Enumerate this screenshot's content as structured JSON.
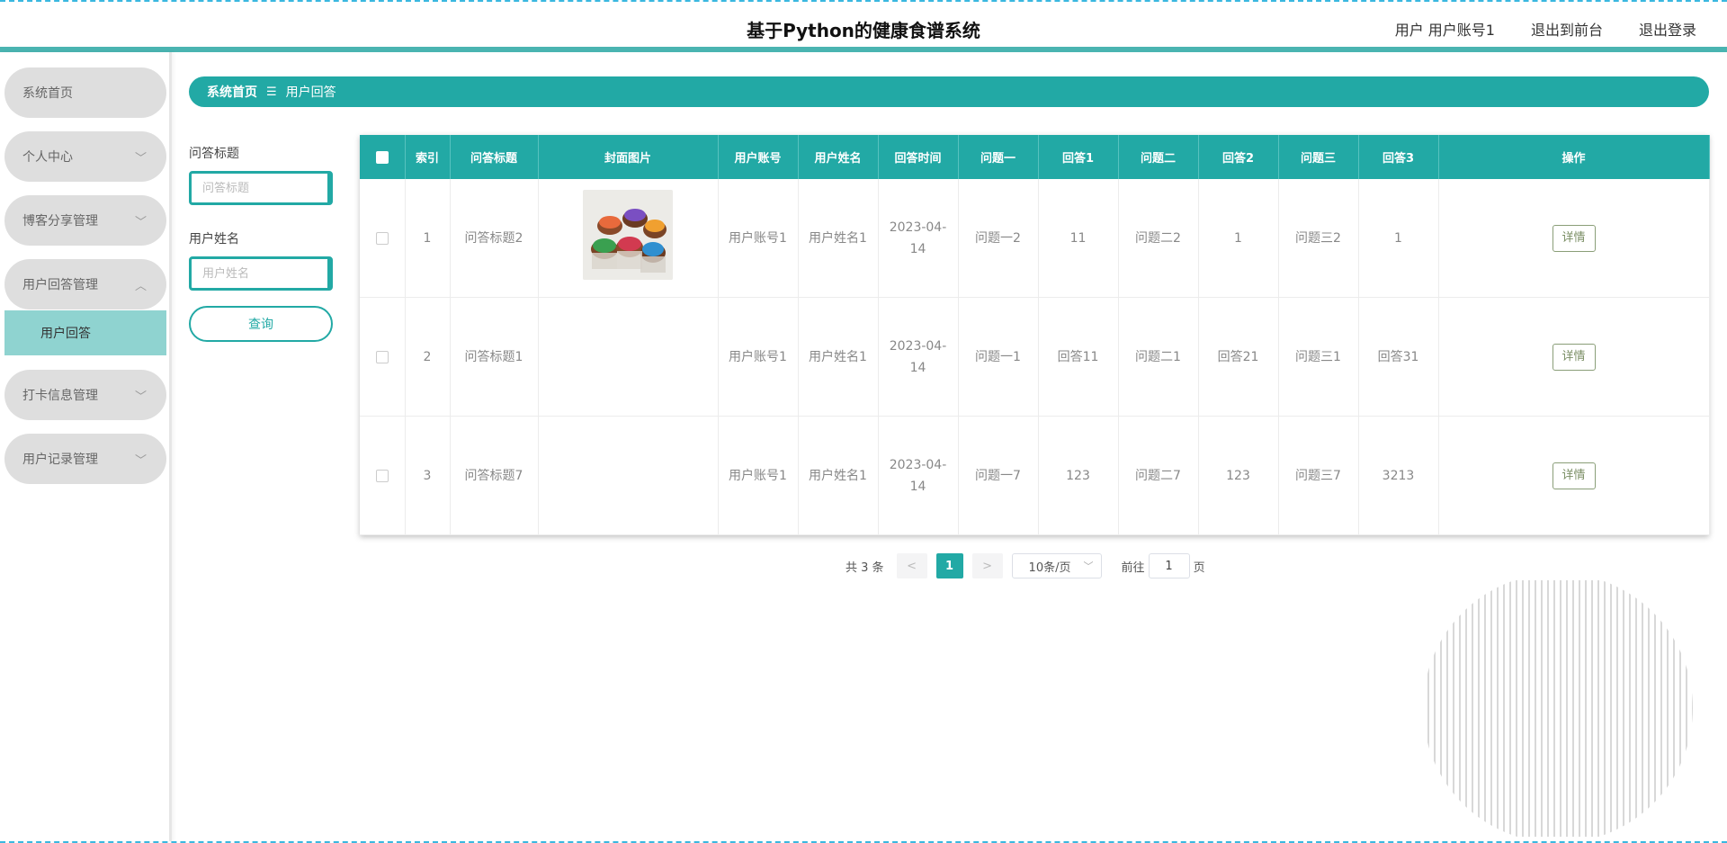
{
  "header": {
    "title": "基于Python的健康食谱系统",
    "user_label": "用户 用户账号1",
    "front_label": "退出到前台",
    "logout_label": "退出登录"
  },
  "sidebar": {
    "items": [
      {
        "label": "系统首页",
        "chevron": ""
      },
      {
        "label": "个人中心",
        "chevron": "﹀"
      },
      {
        "label": "博客分享管理",
        "chevron": "﹀"
      },
      {
        "label": "用户回答管理",
        "chevron": "︿"
      },
      {
        "label": "打卡信息管理",
        "chevron": "﹀"
      },
      {
        "label": "用户记录管理",
        "chevron": "﹀"
      }
    ],
    "sub_active": "用户回答"
  },
  "breadcrumb": {
    "home": "系统首页",
    "sep": "☰",
    "current": "用户回答"
  },
  "filters": {
    "title_label": "问答标题",
    "title_placeholder": "问答标题",
    "name_label": "用户姓名",
    "name_placeholder": "用户姓名",
    "query_label": "查询"
  },
  "table": {
    "headers": [
      "",
      "索引",
      "问答标题",
      "封面图片",
      "用户账号",
      "用户姓名",
      "回答时间",
      "问题一",
      "回答1",
      "问题二",
      "回答2",
      "问题三",
      "回答3",
      "操作"
    ],
    "rows": [
      {
        "index": "1",
        "title": "问答标题2",
        "account": "用户账号1",
        "name": "用户姓名1",
        "time_a": "2023-04-",
        "time_b": "14",
        "q1": "问题一2",
        "a1": "11",
        "q2": "问题二2",
        "a2": "1",
        "q3": "问题三2",
        "a3": "1",
        "action": "详情"
      },
      {
        "index": "2",
        "title": "问答标题1",
        "account": "用户账号1",
        "name": "用户姓名1",
        "time_a": "2023-04-",
        "time_b": "14",
        "q1": "问题一1",
        "a1": "回答11",
        "q2": "问题二1",
        "a2": "回答21",
        "q3": "问题三1",
        "a3": "回答31",
        "action": "详情"
      },
      {
        "index": "3",
        "title": "问答标题7",
        "account": "用户账号1",
        "name": "用户姓名1",
        "time_a": "2023-04-",
        "time_b": "14",
        "q1": "问题一7",
        "a1": "123",
        "q2": "问题二7",
        "a2": "123",
        "q3": "问题三7",
        "a3": "3213",
        "action": "详情"
      }
    ]
  },
  "pagination": {
    "total": "共 3 条",
    "prev": "<",
    "current_page": "1",
    "next": ">",
    "page_size": "10条/页",
    "goto_label": "前往",
    "goto_value": "1",
    "page_suffix": "页"
  },
  "colors": {
    "accent": "#22a9a5",
    "submenu_active": "#8fd3d0",
    "menu_bg": "#dedede"
  }
}
